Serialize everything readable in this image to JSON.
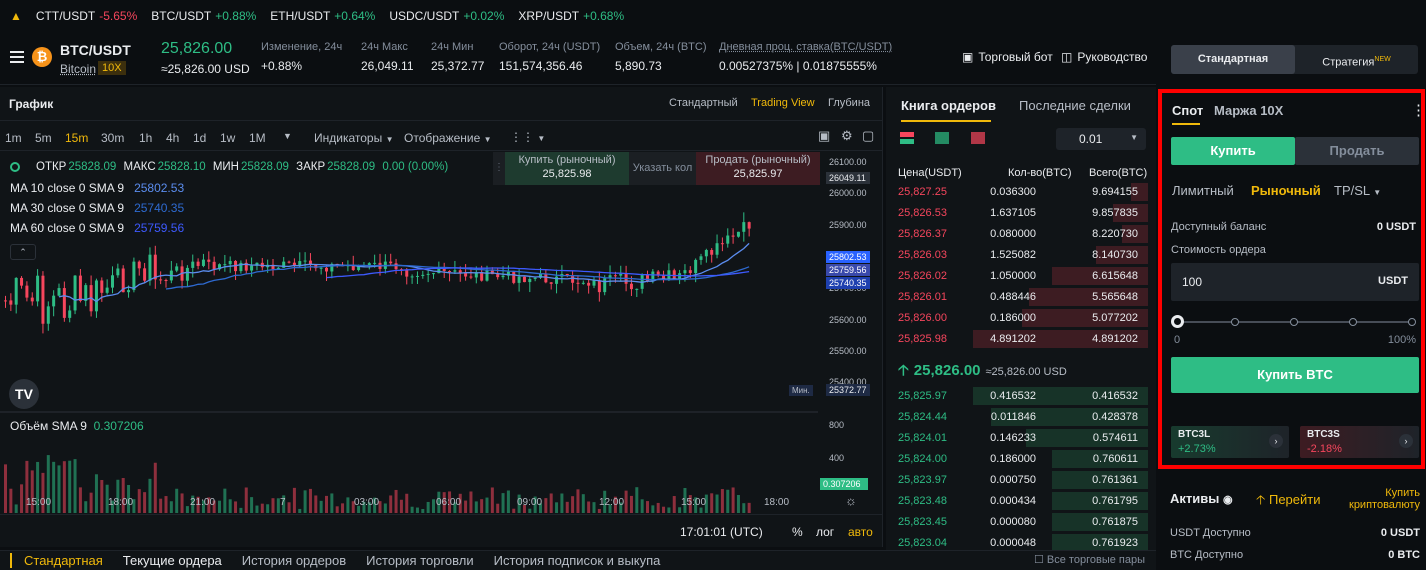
{
  "ticker": [
    {
      "sym": "CTT/USDT",
      "chg": "-5.65%",
      "dir": "red"
    },
    {
      "sym": "BTC/USDT",
      "chg": "+0.88%",
      "dir": "green"
    },
    {
      "sym": "ETH/USDT",
      "chg": "+0.64%",
      "dir": "green"
    },
    {
      "sym": "USDC/USDT",
      "chg": "+0.02%",
      "dir": "green"
    },
    {
      "sym": "XRP/USDT",
      "chg": "+0.68%",
      "dir": "green"
    }
  ],
  "header": {
    "pair": "BTC/USDT",
    "coin": "Bitcoin",
    "leverage": "10X",
    "last": "25,826.00",
    "last_usd": "≈25,826.00 USD",
    "stats": [
      {
        "label": "Изменение, 24ч",
        "value": "+0.88%"
      },
      {
        "label": "24ч Макс",
        "value": "26,049.11"
      },
      {
        "label": "24ч Мин",
        "value": "25,372.77"
      },
      {
        "label": "Оборот, 24ч (USDT)",
        "value": "151,574,356.46"
      },
      {
        "label": "Объем, 24ч (BTC)",
        "value": "5,890.73"
      },
      {
        "label": "Дневная проц. ставка(BTC/USDT)",
        "value": "0.00527375% | 0.01875555%"
      }
    ],
    "bot": "Торговый бот",
    "guide": "Руководство"
  },
  "chart": {
    "title": "График",
    "views": [
      "Стандартный",
      "Trading View",
      "Глубина"
    ],
    "timeframes": [
      "1m",
      "5m",
      "15m",
      "30m",
      "1h",
      "4h",
      "1d",
      "1w",
      "1M"
    ],
    "indicators": "Индикаторы",
    "display": "Отображение",
    "ohlc": {
      "o_label": "ОТКР",
      "o": "25828.09",
      "h_label": "МАКС",
      "h": "25828.10",
      "l_label": "МИН",
      "l": "25828.09",
      "c_label": "ЗАКР",
      "c": "25828.09",
      "chg": "0.00 (0.00%)"
    },
    "ma": [
      {
        "label": "MA 10 close 0 SMA 9",
        "value": "25802.53",
        "color": "#5b8def"
      },
      {
        "label": "MA 30 close 0 SMA 9",
        "value": "25740.35",
        "color": "#2e6ad1"
      },
      {
        "label": "MA 60 close 0 SMA 9",
        "value": "25759.56",
        "color": "#3d5afe"
      }
    ],
    "buy_market": "Купить (рыночный)",
    "buy_price": "25,825.98",
    "specify": "Указать кол",
    "sell_market": "Продать (рыночный)",
    "sell_price": "25,825.97",
    "yticks": [
      "26100.00",
      "26000.00",
      "25900.00",
      "25800.00",
      "25700.00",
      "25600.00",
      "25500.00",
      "25400.00"
    ],
    "xticks": [
      "15:00",
      "18:00",
      "21:00",
      "7",
      "03:00",
      "06:00",
      "09:00",
      "12:00",
      "15:00",
      "18:00"
    ],
    "high_tag": "26049.11",
    "tags": [
      {
        "v": "25802.53",
        "c": "#2962ff"
      },
      {
        "v": "25759.56",
        "c": "#3949ab"
      },
      {
        "v": "25740.35",
        "c": "#1e40af"
      }
    ],
    "min_label": "Мин.",
    "min_tag": "25372.77",
    "volume_label": "Объём SMA 9",
    "volume_value": "0.307206",
    "vol_ticks": [
      "800",
      "400"
    ],
    "clock": "17:01:01 (UTC)",
    "pct": "%",
    "log": "лог",
    "auto": "авто"
  },
  "orderbook": {
    "tabs": [
      "Книга ордеров",
      "Последние сделки"
    ],
    "precision": "0.01",
    "cols": [
      "Цена(USDT)",
      "Кол-во(BTC)",
      "Всего(BTC)"
    ],
    "asks": [
      [
        "25,827.25",
        "0.036300",
        "9.694155",
        0.1
      ],
      [
        "25,826.53",
        "1.637105",
        "9.857835",
        0.2
      ],
      [
        "25,826.37",
        "0.080000",
        "8.220730",
        0.15
      ],
      [
        "25,826.03",
        "1.525082",
        "8.140730",
        0.3
      ],
      [
        "25,826.02",
        "1.050000",
        "6.615648",
        0.55
      ],
      [
        "25,826.01",
        "0.488446",
        "5.565648",
        0.68
      ],
      [
        "25,826.00",
        "0.186000",
        "5.077202",
        0.72
      ],
      [
        "25,825.98",
        "4.891202",
        "4.891202",
        1.0
      ]
    ],
    "mid": "25,826.00",
    "mid_usd": "≈25,826.00 USD",
    "bids": [
      [
        "25,825.97",
        "0.416532",
        "0.416532",
        1.0
      ],
      [
        "25,824.44",
        "0.011846",
        "0.428378",
        0.9
      ],
      [
        "25,824.01",
        "0.146233",
        "0.574611",
        0.7
      ],
      [
        "25,824.00",
        "0.186000",
        "0.760611",
        0.55
      ],
      [
        "25,823.97",
        "0.000750",
        "0.761361",
        0.55
      ],
      [
        "25,823.48",
        "0.000434",
        "0.761795",
        0.55
      ],
      [
        "25,823.45",
        "0.000080",
        "0.761875",
        0.55
      ],
      [
        "25,823.04",
        "0.000048",
        "0.761923",
        0.55
      ]
    ]
  },
  "right": {
    "mode_std": "Стандартная",
    "mode_strat": "Стратегия",
    "new": "NEW",
    "tab_spot": "Спот",
    "tab_margin": "Маржа 10X",
    "buy": "Купить",
    "sell": "Продать",
    "types": [
      "Лимитный",
      "Рыночный",
      "TP/SL"
    ],
    "balance_label": "Доступный баланс",
    "balance": "0 USDT",
    "order_value_label": "Стоимость ордера",
    "order_value": "100",
    "unit": "USDT",
    "slider_min": "0",
    "slider_max": "100%",
    "slider_pct": 0,
    "submit": "Купить BTC",
    "etf": [
      {
        "name": "BTC3L",
        "chg": "+2.73%"
      },
      {
        "name": "BTC3S",
        "chg": "-2.18%"
      }
    ],
    "assets": "Активы",
    "go": "Перейти",
    "buy_crypto": "Купить криптовалюту",
    "usdt_avail": "USDT Доступно",
    "usdt_val": "0 USDT",
    "btc_avail": "BTC Доступно",
    "btc_val": "0 BTC"
  },
  "bottom": {
    "tabs": [
      "Стандартная",
      "Текущие ордера",
      "История ордеров",
      "История торговли",
      "История подписок и выкупа"
    ],
    "all_pairs": "Все торговые пары"
  }
}
